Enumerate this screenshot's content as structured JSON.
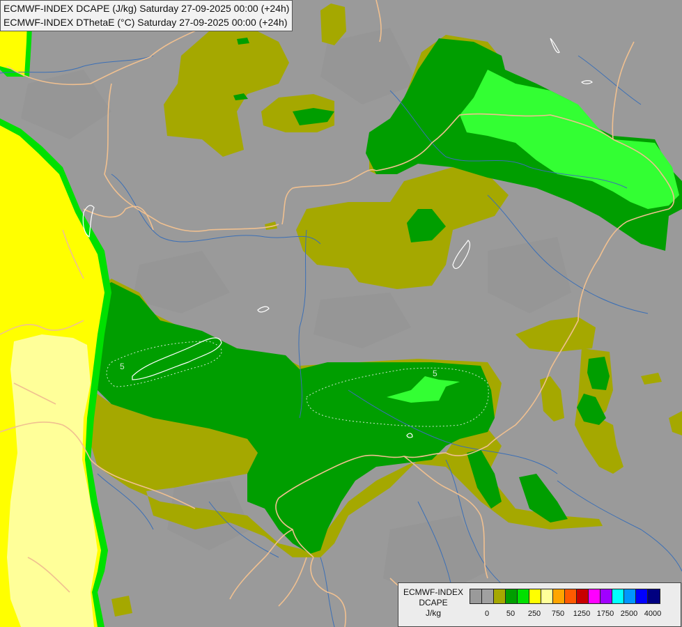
{
  "header": {
    "line1": "ECMWF-INDEX DCAPE (J/kg) Saturday 27-09-2025 00:00 (+24h)",
    "line2": "ECMWF-INDEX DThetaE (°C) Saturday 27-09-2025 00:00 (+24h)"
  },
  "contour_labels": [
    "5",
    "5"
  ],
  "legend": {
    "title_line1": "ECMWF-INDEX",
    "title_line2": "DCAPE",
    "unit": "J/kg",
    "colors": [
      "#9a9a9a",
      "#a0a0a0",
      "#a5a800",
      "#009e00",
      "#00e000",
      "#ffff00",
      "#ffff99",
      "#ffa500",
      "#ff5a00",
      "#c80000",
      "#ff00ff",
      "#a000ff",
      "#00ffff",
      "#0096ff",
      "#0000ff",
      "#000080"
    ],
    "tick_labels": [
      "0",
      "50",
      "250",
      "750",
      "1250",
      "1750",
      "2500",
      "4000"
    ]
  },
  "colors": {
    "background": "#9a9a9a",
    "olive": "#a5a800",
    "green_dark": "#009e00",
    "green_light": "#00e000",
    "green_bright": "#33ff33",
    "yellow": "#ffff00",
    "pale_yellow": "#ffff99",
    "border": "#f0c090",
    "river": "#3b6fb6"
  }
}
